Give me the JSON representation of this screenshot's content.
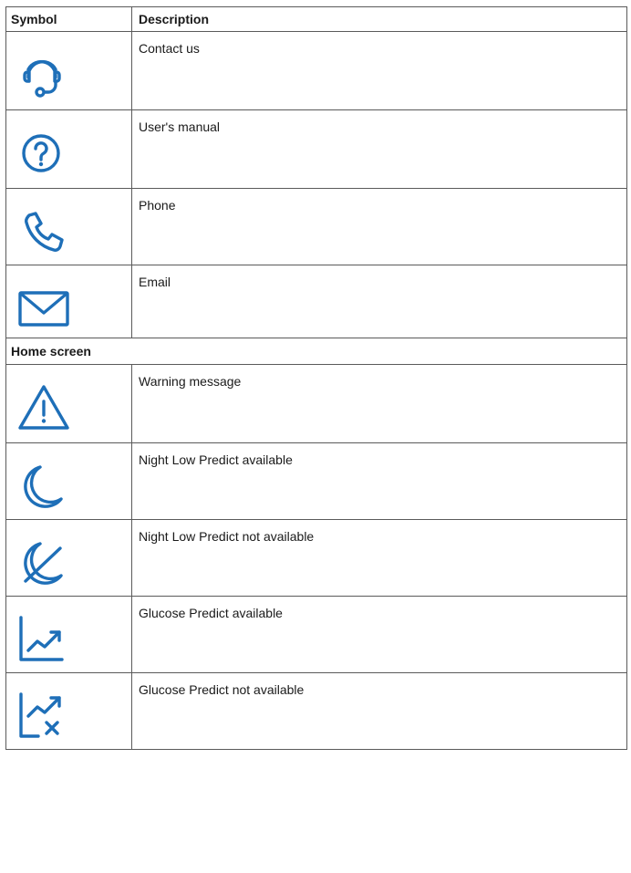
{
  "table": {
    "headers": {
      "symbol": "Symbol",
      "description": "Description"
    },
    "rows": [
      {
        "icon": "headset-icon",
        "description": "Contact us"
      },
      {
        "icon": "question-circle-icon",
        "description": "User's manual"
      },
      {
        "icon": "phone-icon",
        "description": "Phone"
      },
      {
        "icon": "envelope-icon",
        "description": "Email"
      }
    ],
    "section": {
      "title": "Home screen",
      "rows": [
        {
          "icon": "warning-triangle-icon",
          "description": "Warning message"
        },
        {
          "icon": "moon-icon",
          "description": "Night Low Predict available"
        },
        {
          "icon": "moon-crossed-icon",
          "description": "Night Low Predict not available"
        },
        {
          "icon": "trend-up-chart-icon",
          "description": "Glucose Predict available"
        },
        {
          "icon": "trend-up-chart-crossed-icon",
          "description": "Glucose Predict not available"
        }
      ]
    }
  },
  "colors": {
    "icon_blue": "#1e6fb8",
    "border": "#5a5a5a",
    "text": "#1a1a1a"
  }
}
